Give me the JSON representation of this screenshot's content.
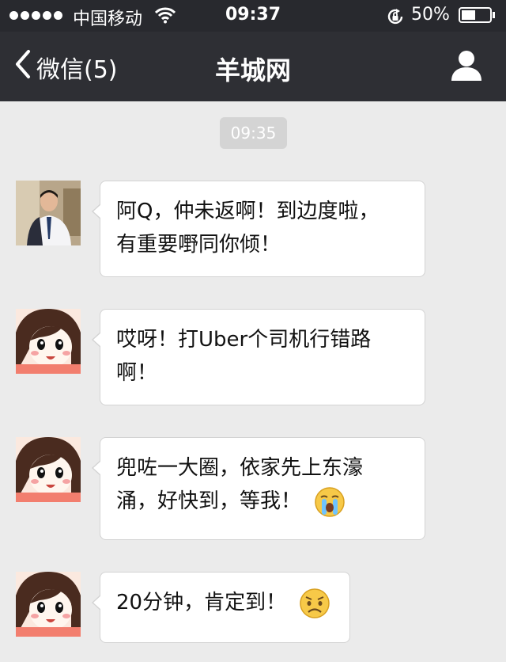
{
  "status_bar": {
    "carrier": "中国移动",
    "time": "09:37",
    "battery_percent": "50%",
    "battery_level": 0.5,
    "icons": [
      "signal-dots-icon",
      "wifi-icon",
      "rotation-lock-icon",
      "battery-icon"
    ]
  },
  "nav": {
    "back_label": "微信(5)",
    "title": "羊城网",
    "icons": [
      "chevron-left-icon",
      "profile-icon"
    ]
  },
  "chat": {
    "timestamp": "09:35",
    "messages": [
      {
        "sender": "contact-man",
        "lines": [
          "阿Q，仲未返啊！到边度啦，",
          "有重要嘢同你倾！"
        ],
        "emoji": null
      },
      {
        "sender": "contact-girl",
        "lines": [
          "哎呀！打Uber个司机行错路",
          "啊！"
        ],
        "emoji": null
      },
      {
        "sender": "contact-girl",
        "lines": [
          "兜咗一大圈，依家先上东濠",
          "涌，好快到，等我！"
        ],
        "emoji": "crying-face-icon"
      },
      {
        "sender": "contact-girl",
        "lines": [
          "20分钟，肯定到！"
        ],
        "emoji": "worried-face-icon"
      }
    ]
  },
  "colors": {
    "status_bar_bg": "#28292e",
    "nav_bar_bg": "#2e2f34",
    "chat_bg": "#ebebeb",
    "bubble_bg": "#ffffff",
    "timestamp_bg": "#d4d4d4"
  }
}
